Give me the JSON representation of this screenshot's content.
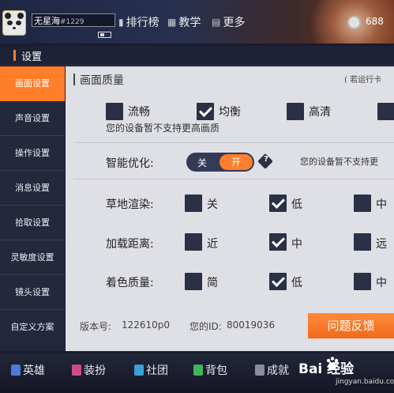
{
  "top": {
    "player_name": "无星海",
    "player_tag": "#1229",
    "nav": [
      {
        "icon": "bar-chart-icon",
        "label": "排行榜"
      },
      {
        "icon": "book-icon",
        "label": "教学"
      },
      {
        "icon": "grid-icon",
        "label": "更多"
      }
    ],
    "coins": "688"
  },
  "settings": {
    "title": "设置",
    "menu": [
      "画面设置",
      "声音设置",
      "操作设置",
      "消息设置",
      "拾取设置",
      "灵敏度设置",
      "镜头设置",
      "自定义方案"
    ],
    "active_index": 0
  },
  "panel": {
    "section_title": "画面质量",
    "note_right": "( 若运行卡",
    "quality_options": [
      {
        "label": "流畅",
        "checked": false
      },
      {
        "label": "均衡",
        "checked": true
      },
      {
        "label": "高清",
        "checked": false
      }
    ],
    "quality_hint": "您的设备暂不支持更高画质",
    "smart_opt": {
      "label": "智能优化:",
      "off_label": "关",
      "on_label": "开",
      "help_glyph": "?",
      "hint": "您的设备暂不支持更"
    },
    "rows": [
      {
        "label": "草地渲染:",
        "options": [
          {
            "label": "关",
            "checked": false
          },
          {
            "label": "低",
            "checked": true
          },
          {
            "label": "中",
            "checked": false
          }
        ]
      },
      {
        "label": "加载距离:",
        "options": [
          {
            "label": "近",
            "checked": false
          },
          {
            "label": "中",
            "checked": true
          },
          {
            "label": "远",
            "checked": false
          }
        ]
      },
      {
        "label": "着色质量:",
        "options": [
          {
            "label": "简",
            "checked": false
          },
          {
            "label": "低",
            "checked": true
          },
          {
            "label": "中",
            "checked": false
          }
        ]
      }
    ],
    "version_label": "版本号:",
    "version_value": "122610p0",
    "id_label": "您的ID:",
    "id_value": "80019036",
    "feedback_label": "问题反馈"
  },
  "bottom": {
    "nav": [
      {
        "label": "英雄",
        "color": "#4a7bd6"
      },
      {
        "label": "装扮",
        "color": "#d04a8a"
      },
      {
        "label": "社团",
        "color": "#3aa0d8"
      },
      {
        "label": "背包",
        "color": "#3fb55a"
      },
      {
        "label": "成就",
        "color": "#8a8da0"
      }
    ],
    "watermark": "Bai 经验",
    "watermark_sub": "jingyan.baidu.com"
  }
}
